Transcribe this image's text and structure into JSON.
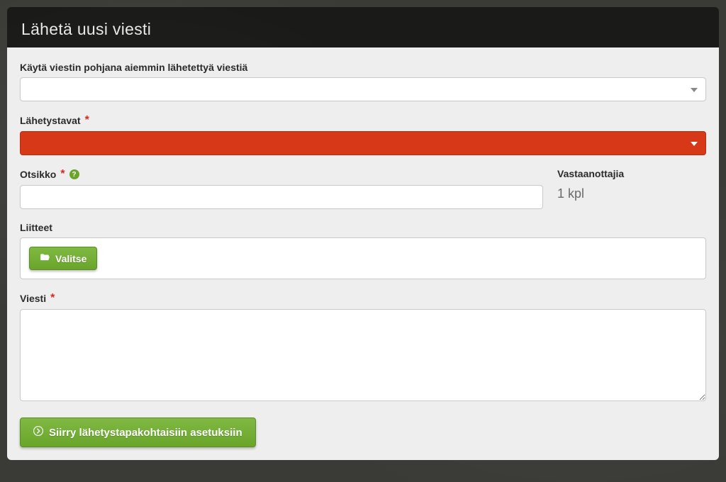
{
  "header": {
    "title": "Lähetä uusi viesti"
  },
  "form": {
    "template": {
      "label": "Käytä viestin pohjana aiemmin lähetettyä viestiä",
      "value": ""
    },
    "delivery": {
      "label": "Lähetystavat",
      "required": "*",
      "value": ""
    },
    "subject": {
      "label": "Otsikko",
      "required": "*",
      "value": ""
    },
    "recipients": {
      "label": "Vastaanottajia",
      "count": "1 kpl"
    },
    "attachments": {
      "label": "Liitteet",
      "button": "Valitse"
    },
    "message": {
      "label": "Viesti",
      "required": "*",
      "value": ""
    },
    "submit": {
      "label": "Siirry lähetystapakohtaisiin asetuksiin"
    }
  },
  "help_tooltip": "?"
}
